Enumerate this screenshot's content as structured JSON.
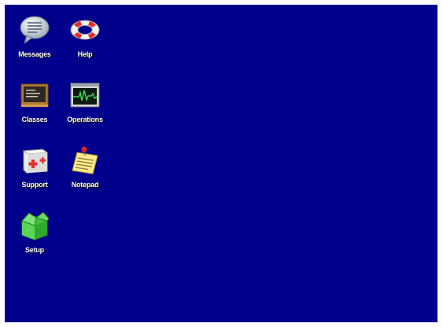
{
  "desktop": {
    "background_color": "#00008c",
    "icons": [
      {
        "label": "Messages",
        "icon": "speech-bubble-icon"
      },
      {
        "label": "Help",
        "icon": "lifebuoy-icon"
      },
      {
        "label": "Classes",
        "icon": "chalkboard-icon"
      },
      {
        "label": "Operations",
        "icon": "heart-monitor-icon"
      },
      {
        "label": "Support",
        "icon": "first-aid-kit-icon"
      },
      {
        "label": "Notepad",
        "icon": "notepad-icon"
      },
      {
        "label": "Setup",
        "icon": "green-box-icon"
      }
    ]
  }
}
